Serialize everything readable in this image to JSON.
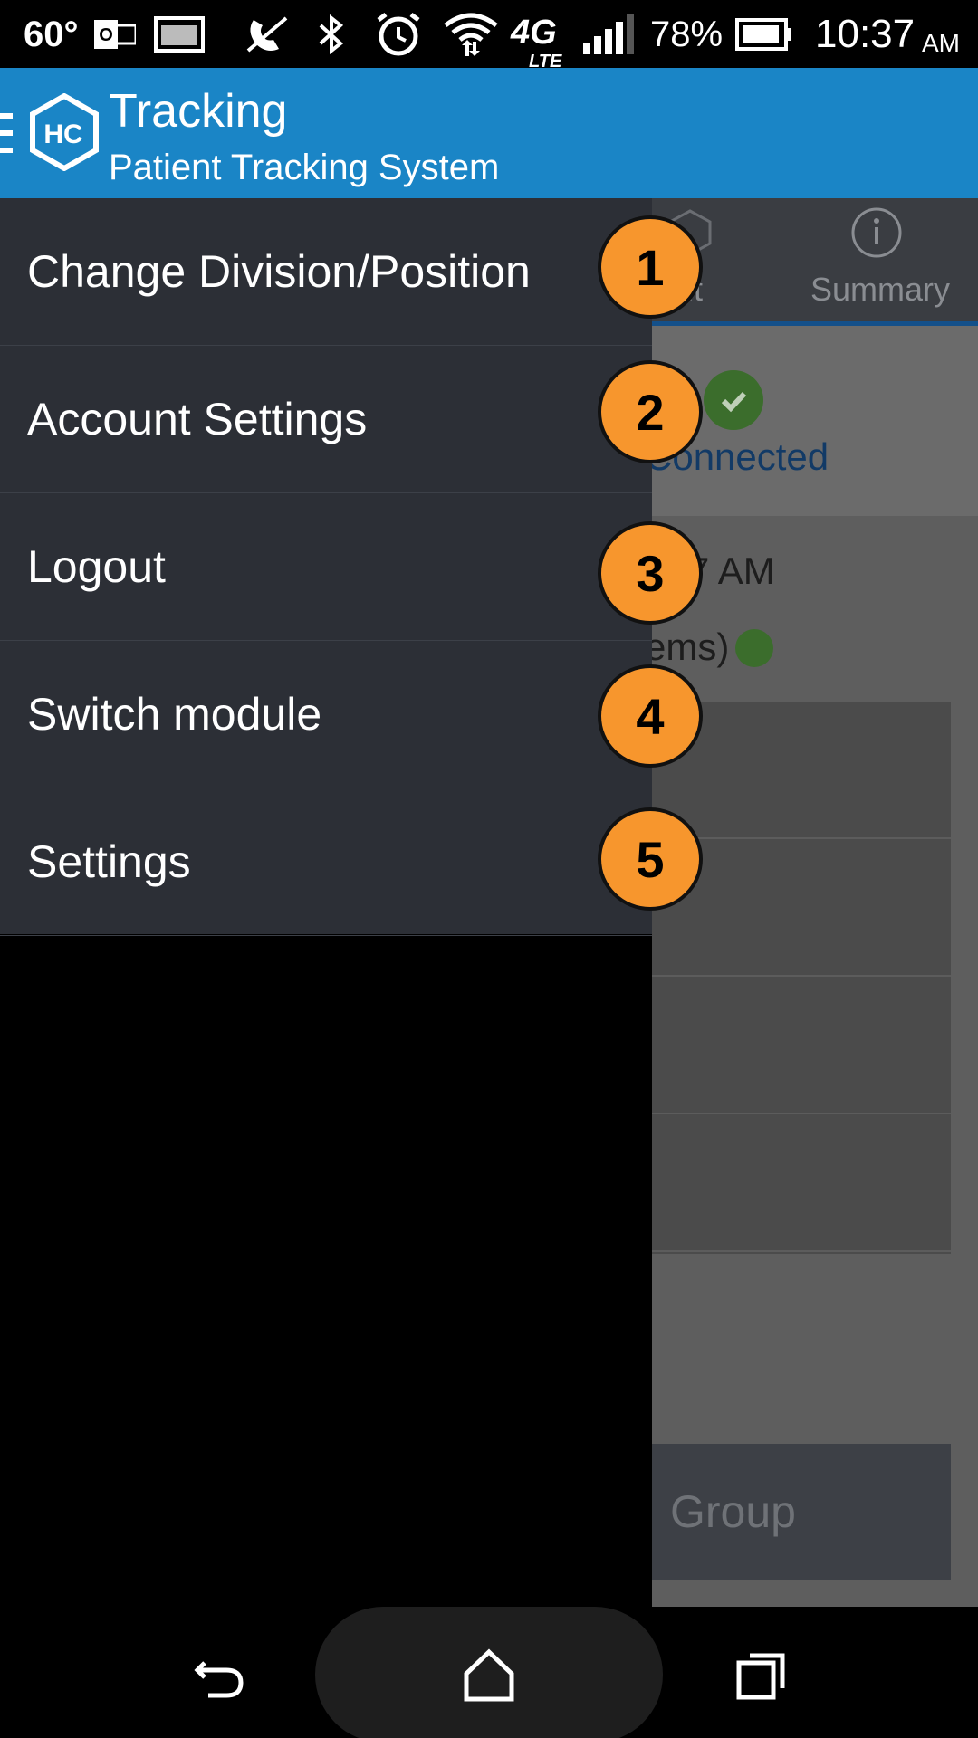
{
  "status_bar": {
    "temperature": "60°",
    "battery": "78%",
    "time": "10:37",
    "ampm": "AM",
    "network": "4G",
    "network_sub": "LTE",
    "icons": [
      "outlook-icon",
      "image-icon",
      "no-call-icon",
      "bluetooth-icon",
      "alarm-icon",
      "wifi-icon",
      "signal-icon",
      "battery-icon"
    ]
  },
  "app_bar": {
    "logo_text": "HC",
    "title": "Tracking",
    "subtitle": "Patient Tracking System",
    "color": "#1a85c6"
  },
  "drawer": {
    "items": [
      {
        "label": "Change Division/Position",
        "badge": "1"
      },
      {
        "label": "Account Settings",
        "badge": "2"
      },
      {
        "label": "Logout",
        "badge": "3"
      },
      {
        "label": "Switch module",
        "badge": "4"
      },
      {
        "label": "Settings",
        "badge": "5"
      }
    ]
  },
  "background": {
    "tab_partial": "ut",
    "tab_summary": "Summary",
    "connected_text": "Connected",
    "time_text": "7 AM",
    "items_text": "ems)",
    "group_button": "Group"
  },
  "nav_bar": {
    "icons": [
      "back-icon",
      "home-icon",
      "recents-icon"
    ]
  },
  "colors": {
    "badge": "#f7962d",
    "drawer": "#2c2f36",
    "accent": "#1a85c6"
  }
}
